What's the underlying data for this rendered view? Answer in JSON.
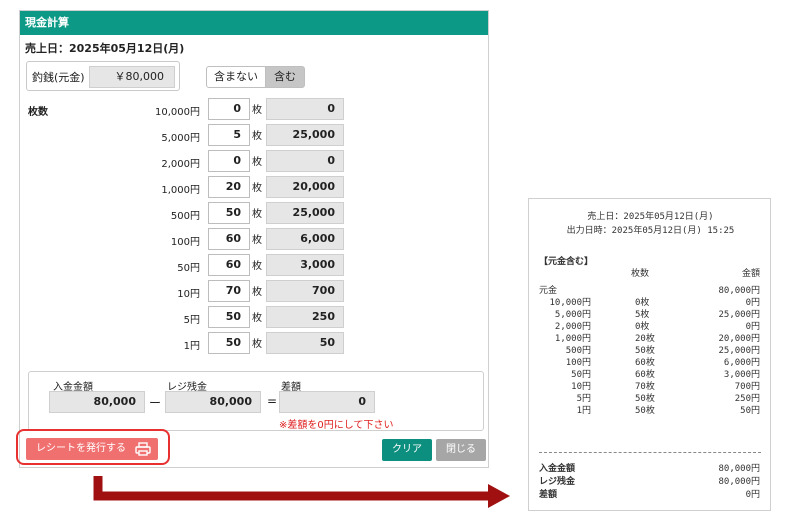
{
  "header": {
    "title": "現金計算"
  },
  "sales_date": "売上日：2025年05月12日(月)",
  "change_fund": {
    "label": "釣銭(元金)",
    "value": "￥80,000"
  },
  "toggle": {
    "exclude": "含まない",
    "include": "含む"
  },
  "count_label": "枚数",
  "unit": "枚",
  "rows": [
    {
      "denom": "10,000円",
      "qty": "0",
      "amount": "0"
    },
    {
      "denom": "5,000円",
      "qty": "5",
      "amount": "25,000"
    },
    {
      "denom": "2,000円",
      "qty": "0",
      "amount": "0"
    },
    {
      "denom": "1,000円",
      "qty": "20",
      "amount": "20,000"
    },
    {
      "denom": "500円",
      "qty": "50",
      "amount": "25,000"
    },
    {
      "denom": "100円",
      "qty": "60",
      "amount": "6,000"
    },
    {
      "denom": "50円",
      "qty": "60",
      "amount": "3,000"
    },
    {
      "denom": "10円",
      "qty": "70",
      "amount": "700"
    },
    {
      "denom": "5円",
      "qty": "50",
      "amount": "250"
    },
    {
      "denom": "1円",
      "qty": "50",
      "amount": "50"
    }
  ],
  "summary": {
    "deposit_label": "入金金額",
    "deposit_value": "80,000",
    "minus": "ー",
    "register_label": "レジ残金",
    "register_value": "80,000",
    "equals": "=",
    "diff_label": "差額",
    "diff_value": "0",
    "warning": "※差額を0円にして下さい"
  },
  "buttons": {
    "receipt": "レシートを発行する",
    "clear": "クリア",
    "close": "閉じる"
  },
  "colors": {
    "header": "#0c9a87",
    "receipt_button": "#f07070",
    "highlight": "#e83030",
    "arrow": "#a01010",
    "warning": "#e02020"
  },
  "receipt": {
    "sales_date": "売上日：2025年05月12日(月)",
    "output_time": "出力日時：2025年05月12日(月) 15:25",
    "section": "【元金含む】",
    "col_count": "枚数",
    "col_amount": "金額",
    "base_label": "元金",
    "base_amount": "80,000円",
    "lines": [
      {
        "denom": "10,000円",
        "count": "0枚",
        "amount": "0円"
      },
      {
        "denom": "5,000円",
        "count": "5枚",
        "amount": "25,000円"
      },
      {
        "denom": "2,000円",
        "count": "0枚",
        "amount": "0円"
      },
      {
        "denom": "1,000円",
        "count": "20枚",
        "amount": "20,000円"
      },
      {
        "denom": "500円",
        "count": "50枚",
        "amount": "25,000円"
      },
      {
        "denom": "100円",
        "count": "60枚",
        "amount": "6,000円"
      },
      {
        "denom": "50円",
        "count": "60枚",
        "amount": "3,000円"
      },
      {
        "denom": "10円",
        "count": "70枚",
        "amount": "700円"
      },
      {
        "denom": "5円",
        "count": "50枚",
        "amount": "250円"
      },
      {
        "denom": "1円",
        "count": "50枚",
        "amount": "50円"
      }
    ],
    "deposit_label": "入金金額",
    "deposit_value": "80,000円",
    "register_label": "レジ残金",
    "register_value": "80,000円",
    "diff_label": "差額",
    "diff_value": "0円"
  }
}
